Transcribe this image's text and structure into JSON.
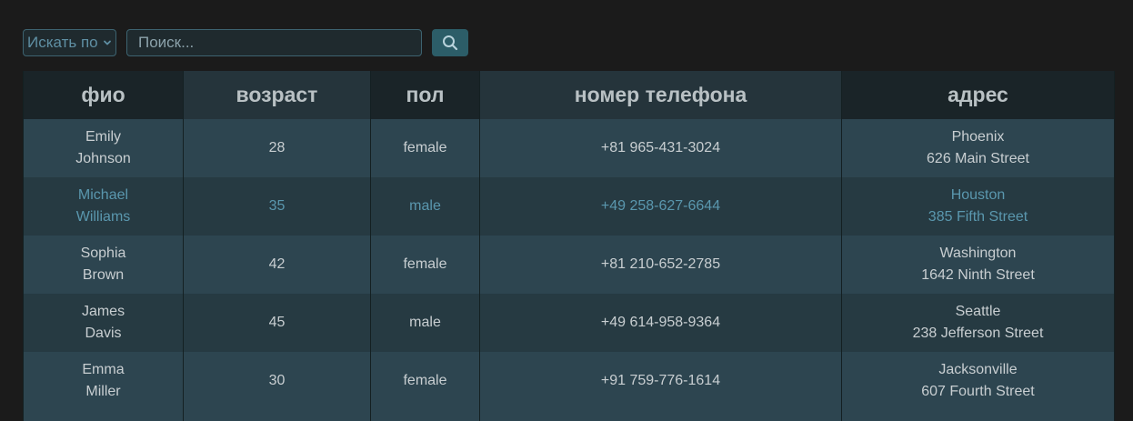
{
  "search": {
    "select_label": "Искать по",
    "placeholder": "Поиск...",
    "value": ""
  },
  "icons": {
    "select_chevron": "chevron-down-icon",
    "search_button": "search-icon"
  },
  "colors": {
    "page_bg": "#1b1b1b",
    "header_dark": "#1a2428",
    "header_mid": "#25343b",
    "row_odd": "#2d4550",
    "row_even": "#263a42",
    "accent": "#2c5d68",
    "highlight_text": "#5a97ae"
  },
  "table": {
    "headers": [
      "фио",
      "возраст",
      "пол",
      "номер телефона",
      "адрес"
    ],
    "rows": [
      {
        "name_first": "Emily",
        "name_last": "Johnson",
        "age": "28",
        "gender": "female",
        "phone": "+81 965-431-3024",
        "city": "Phoenix",
        "street": "626 Main Street"
      },
      {
        "name_first": "Michael",
        "name_last": "Williams",
        "age": "35",
        "gender": "male",
        "phone": "+49 258-627-6644",
        "city": "Houston",
        "street": "385 Fifth Street"
      },
      {
        "name_first": "Sophia",
        "name_last": "Brown",
        "age": "42",
        "gender": "female",
        "phone": "+81 210-652-2785",
        "city": "Washington",
        "street": "1642 Ninth Street"
      },
      {
        "name_first": "James",
        "name_last": "Davis",
        "age": "45",
        "gender": "male",
        "phone": "+49 614-958-9364",
        "city": "Seattle",
        "street": "238 Jefferson Street"
      },
      {
        "name_first": "Emma",
        "name_last": "Miller",
        "age": "30",
        "gender": "female",
        "phone": "+91 759-776-1614",
        "city": "Jacksonville",
        "street": "607 Fourth Street"
      }
    ]
  }
}
